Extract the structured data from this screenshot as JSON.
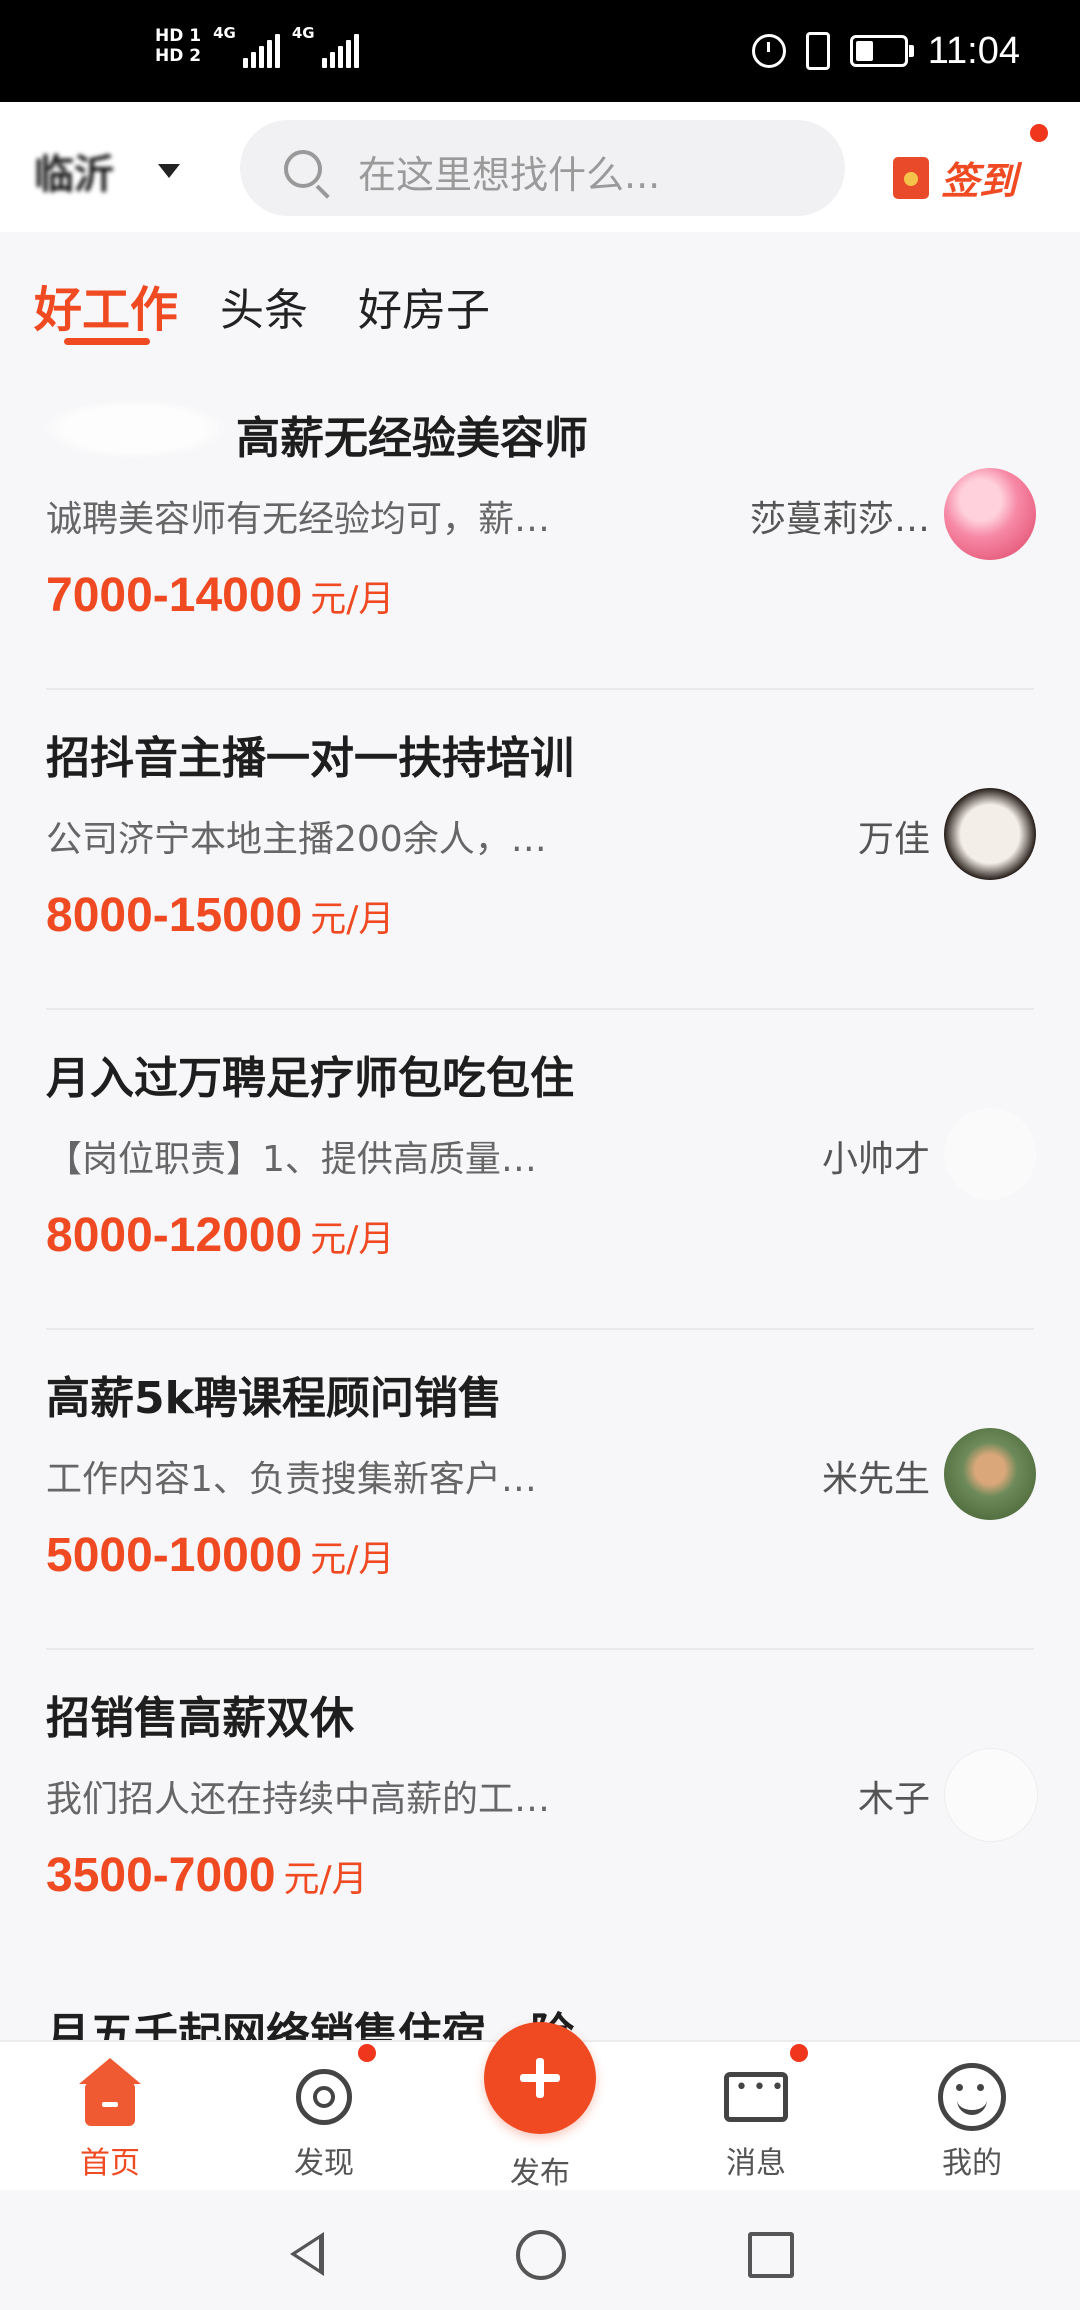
{
  "status_bar": {
    "time": "11:04",
    "sim1": "HD 1",
    "sim2": "HD 2",
    "network1": "4G",
    "network2": "4G"
  },
  "header": {
    "city": "临沂",
    "search_placeholder": "在这里想找什么...",
    "checkin_label": "签到"
  },
  "tabs": [
    {
      "label": "好工作",
      "active": true
    },
    {
      "label": "头条",
      "active": false
    },
    {
      "label": "好房子",
      "active": false
    }
  ],
  "jobs": [
    {
      "title": "高薪无经验美容师",
      "desc": "诚聘美容师有无经验均可，薪…",
      "author": "莎蔓莉莎…",
      "salary": "7000-14000",
      "unit": "元/月"
    },
    {
      "title": "招抖音主播一对一扶持培训",
      "desc": "公司济宁本地主播200余人，…",
      "author": "万佳",
      "salary": "8000-15000",
      "unit": "元/月"
    },
    {
      "title": "月入过万聘足疗师包吃包住",
      "desc": "【岗位职责】1、提供高质量…",
      "author": "小帅才",
      "salary": "8000-12000",
      "unit": "元/月"
    },
    {
      "title": "高薪5k聘课程顾问销售",
      "desc": "工作内容1、负责搜集新客户…",
      "author": "米先生",
      "salary": "5000-10000",
      "unit": "元/月"
    },
    {
      "title": "招销售高薪双休",
      "desc": "我们招人还在持续中高薪的工…",
      "author": "木子",
      "salary": "3500-7000",
      "unit": "元/月"
    }
  ],
  "peek_title": "月五千起网络销售住宿…险",
  "bottom_nav": {
    "home": "首页",
    "discover": "发现",
    "publish": "发布",
    "messages": "消息",
    "mine": "我的"
  },
  "colors": {
    "accent": "#ef4a22",
    "badge": "#f0361c"
  }
}
